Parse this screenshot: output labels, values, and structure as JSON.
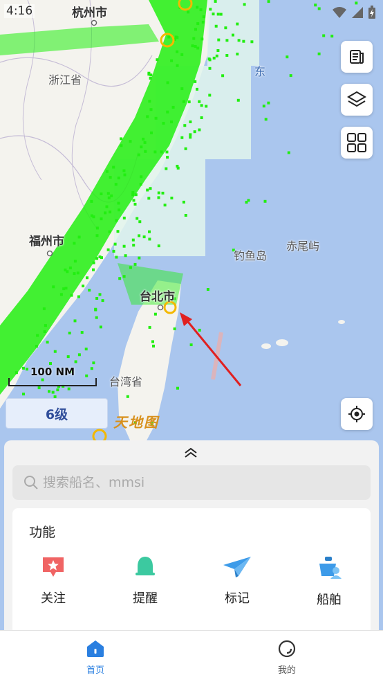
{
  "status_bar": {
    "time": "4:16",
    "icons": [
      "wifi-icon",
      "cell-signal-icon",
      "battery-charging-icon"
    ]
  },
  "map": {
    "labels": {
      "hangzhou": "杭州市",
      "zhejiang": "浙江省",
      "fuzhou": "福州市",
      "taipei": "台北市",
      "taiwan": "台湾省",
      "diaoyu": "钓鱼岛",
      "chiwei": "赤尾屿",
      "east": "东"
    },
    "scale_label": "100 NM",
    "zoom_level": "6级",
    "watermark": "天地图",
    "colors": {
      "ship": "#22ee11",
      "land": "#f4f3ee",
      "sea": "#aac6ee",
      "arrow": "#e02020",
      "port": "#f3b800"
    }
  },
  "side_buttons": [
    "news-icon",
    "layers-icon",
    "grid-apps-icon",
    "locate-icon"
  ],
  "panel": {
    "search_placeholder": "搜索船名、mmsi",
    "function_title": "功能",
    "functions": [
      {
        "label": "关注",
        "icon": "favorite-star-icon",
        "color": "#f06464"
      },
      {
        "label": "提醒",
        "icon": "bell-icon",
        "color": "#3cc9a0"
      },
      {
        "label": "标记",
        "icon": "paper-plane-icon",
        "color": "#3d9be9"
      },
      {
        "label": "船舶",
        "icon": "ship-icon",
        "color": "#3d9be9"
      }
    ]
  },
  "bottom_nav": {
    "items": [
      {
        "label": "首页",
        "icon": "home-icon",
        "active": true
      },
      {
        "label": "我的",
        "icon": "profile-icon",
        "active": false
      }
    ],
    "active_color": "#2a7fe0"
  }
}
